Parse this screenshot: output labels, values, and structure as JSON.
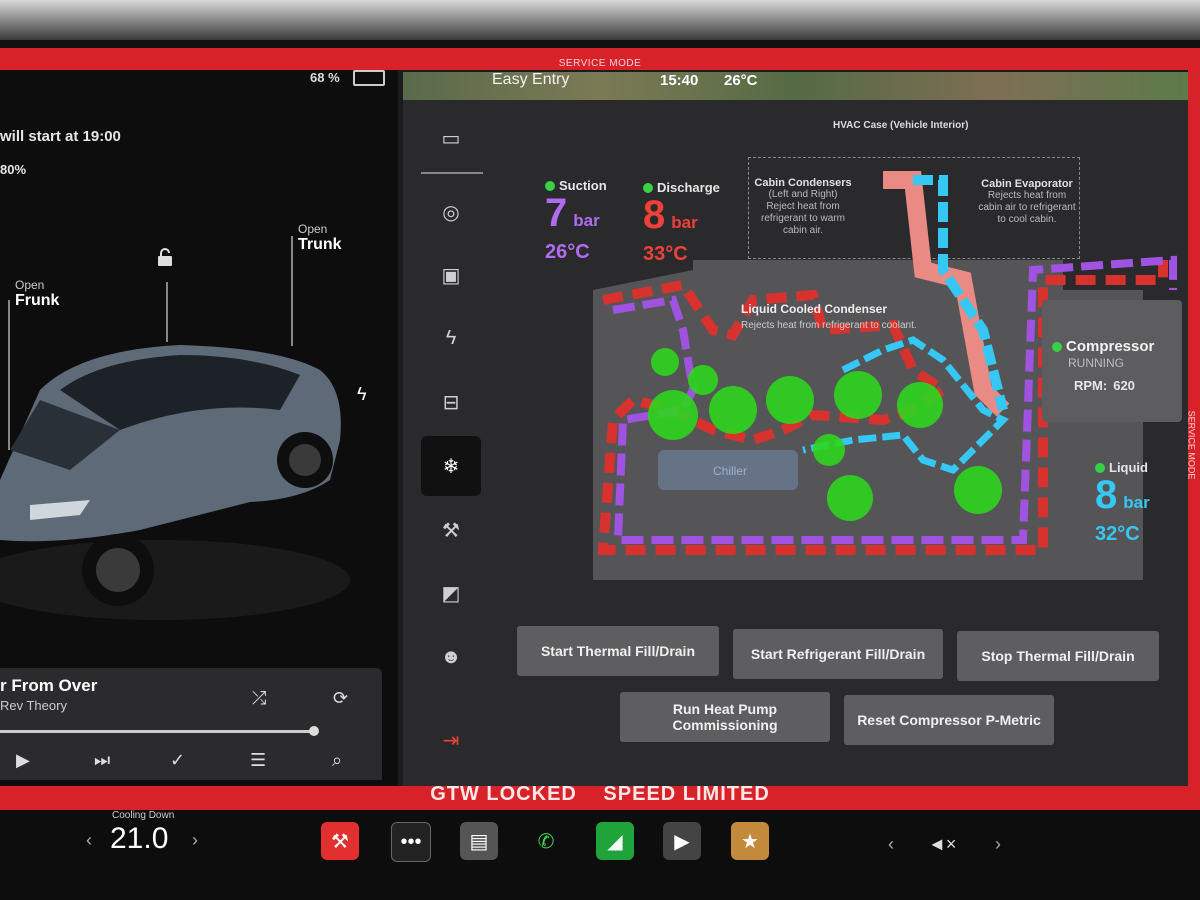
{
  "service_banner": "SERVICE MODE",
  "status_bar": {
    "battery": "68 %",
    "profile": "Easy Entry",
    "time": "15:40",
    "temperature": "26°C"
  },
  "left_panel": {
    "charge_schedule": "will start at 19:00",
    "charge_limit": "80%",
    "frunk": {
      "small": "Open",
      "big": "Frunk"
    },
    "trunk": {
      "small": "Open",
      "big": "Trunk"
    }
  },
  "media": {
    "song": "r From Over",
    "artist": "Rev Theory",
    "progress": 0.8
  },
  "hvac": {
    "title": "HVAC Case (Vehicle Interior)",
    "cabin_condensers": {
      "title": "Cabin Condensers",
      "sub": "(Left and Right)",
      "desc": "Reject heat from refrigerant to warm cabin air."
    },
    "cabin_evaporator": {
      "title": "Cabin Evaporator",
      "desc": "Rejects heat from cabin air to refrigerant to cool cabin."
    },
    "liquid_cooled_condenser": {
      "title": "Liquid Cooled Condenser",
      "desc": "Rejects heat from refrigerant to coolant."
    },
    "chiller": "Chiller"
  },
  "gauges": {
    "suction": {
      "label": "Suction",
      "value": "7",
      "unit": "bar",
      "temp": "26°C",
      "color": "#b06cf0"
    },
    "discharge": {
      "label": "Discharge",
      "value": "8",
      "unit": "bar",
      "temp": "33°C",
      "color": "#f0403a"
    },
    "liquid": {
      "label": "Liquid",
      "value": "8",
      "unit": "bar",
      "temp": "32°C",
      "color": "#35c8f4"
    }
  },
  "compressor": {
    "title": "Compressor",
    "state": "RUNNING",
    "rpm_label": "RPM:",
    "rpm": "620"
  },
  "buttons": {
    "start_thermal": "Start Thermal Fill/Drain",
    "start_refrigerant": "Start Refrigerant Fill/Drain",
    "stop_thermal": "Stop Thermal Fill/Drain",
    "run_heat_pump": "Run Heat Pump Commissioning",
    "reset_compressor": "Reset Compressor P-Metric"
  },
  "warnings": {
    "gtw": "GTW LOCKED",
    "speed": "SPEED LIMITED"
  },
  "climate": {
    "label": "Cooling Down",
    "value": "21.0"
  },
  "menu_icons": [
    "car-icon",
    "steering-icon",
    "chip-icon",
    "bolt-icon",
    "battery-icon",
    "snowflake-icon",
    "wrench-icon",
    "door-icon",
    "person-icon",
    "exit-icon"
  ]
}
